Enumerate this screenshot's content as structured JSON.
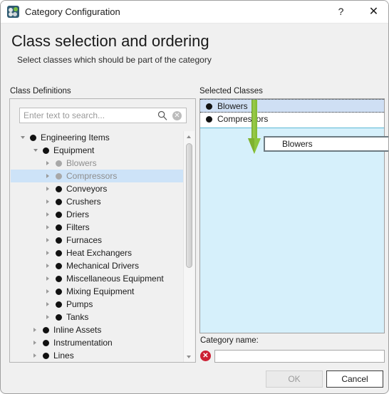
{
  "window": {
    "title": "Category Configuration",
    "icon": "app-icon",
    "help_label": "?",
    "close_label": "✕"
  },
  "header": {
    "title": "Class selection and ordering",
    "subtitle": "Select classes which should be part of the category"
  },
  "left": {
    "section_label": "Class Definitions",
    "search": {
      "placeholder": "Enter text to search...",
      "value": "",
      "search_icon": "magnifier-icon",
      "clear_icon": "clear-circle-icon",
      "clear_glyph": "✕"
    },
    "tree": [
      {
        "label": "Engineering Items",
        "depth": 0,
        "state": "expanded",
        "used": false,
        "selected": false
      },
      {
        "label": "Equipment",
        "depth": 1,
        "state": "expanded",
        "used": false,
        "selected": false
      },
      {
        "label": "Blowers",
        "depth": 2,
        "state": "collapsed",
        "used": true,
        "selected": false
      },
      {
        "label": "Compressors",
        "depth": 2,
        "state": "collapsed",
        "used": true,
        "selected": true
      },
      {
        "label": "Conveyors",
        "depth": 2,
        "state": "collapsed",
        "used": false,
        "selected": false
      },
      {
        "label": "Crushers",
        "depth": 2,
        "state": "collapsed",
        "used": false,
        "selected": false
      },
      {
        "label": "Driers",
        "depth": 2,
        "state": "collapsed",
        "used": false,
        "selected": false
      },
      {
        "label": "Filters",
        "depth": 2,
        "state": "collapsed",
        "used": false,
        "selected": false
      },
      {
        "label": "Furnaces",
        "depth": 2,
        "state": "collapsed",
        "used": false,
        "selected": false
      },
      {
        "label": "Heat Exchangers",
        "depth": 2,
        "state": "collapsed",
        "used": false,
        "selected": false
      },
      {
        "label": "Mechanical Drivers",
        "depth": 2,
        "state": "collapsed",
        "used": false,
        "selected": false
      },
      {
        "label": "Miscellaneous Equipment",
        "depth": 2,
        "state": "collapsed",
        "used": false,
        "selected": false
      },
      {
        "label": "Mixing Equipment",
        "depth": 2,
        "state": "collapsed",
        "used": false,
        "selected": false
      },
      {
        "label": "Pumps",
        "depth": 2,
        "state": "collapsed",
        "used": false,
        "selected": false
      },
      {
        "label": "Tanks",
        "depth": 2,
        "state": "collapsed",
        "used": false,
        "selected": false
      },
      {
        "label": "Inline Assets",
        "depth": 1,
        "state": "collapsed",
        "used": false,
        "selected": false
      },
      {
        "label": "Instrumentation",
        "depth": 1,
        "state": "collapsed",
        "used": false,
        "selected": false
      },
      {
        "label": "Lines",
        "depth": 1,
        "state": "collapsed",
        "used": false,
        "selected": false
      }
    ]
  },
  "right": {
    "section_label": "Selected Classes",
    "items": [
      {
        "label": "Blowers",
        "selected": true
      },
      {
        "label": "Compressors",
        "selected": false
      }
    ],
    "drag": {
      "ghost_label": "Blowers",
      "arrow_color": "#8cc63e",
      "dropzone_color": "#d6f0fb"
    }
  },
  "category": {
    "label": "Category name:",
    "value": "",
    "placeholder": "",
    "error_icon": "error-circle-icon",
    "error_glyph": "✕"
  },
  "footer": {
    "ok_label": "OK",
    "ok_enabled": false,
    "cancel_label": "Cancel",
    "cancel_enabled": true
  },
  "colors": {
    "selection_blue": "#cde3f8",
    "dropzone_blue": "#d6f0fb",
    "error_red": "#cc2034",
    "drag_green": "#8cc63e"
  }
}
